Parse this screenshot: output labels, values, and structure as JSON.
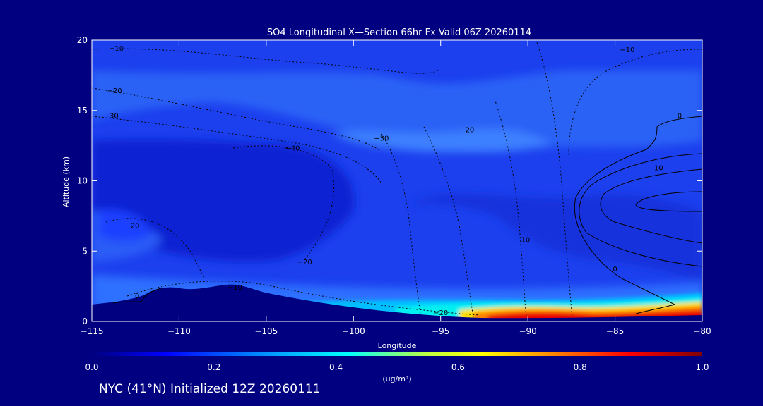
{
  "chart_data": {
    "type": "heatmap",
    "title": "SO4 Longitudinal X—Section 66hr  Fx Valid 06Z 20260114",
    "xlabel": "Longitude",
    "ylabel": "Altitude (km)",
    "xlim": [
      -115,
      -80
    ],
    "ylim": [
      0,
      20
    ],
    "x_ticks": [
      -115,
      -110,
      -105,
      -100,
      -95,
      -90,
      -85,
      -80
    ],
    "x_tick_labels": [
      "−115",
      "−110",
      "−105",
      "−100",
      "−95",
      "−90",
      "−85",
      "−80"
    ],
    "y_ticks": [
      0,
      5,
      10,
      15,
      20
    ],
    "y_tick_labels": [
      "0",
      "5",
      "10",
      "15",
      "20"
    ],
    "colorbar": {
      "label": "(ug/m³)",
      "range": [
        0.0,
        1.0
      ],
      "ticks": [
        0.0,
        0.2,
        0.4,
        0.6,
        0.8,
        1.0
      ],
      "tick_labels": [
        "0.0",
        "0.2",
        "0.4",
        "0.6",
        "0.8",
        "1.0"
      ],
      "colormap": [
        "#000080",
        "#0000ff",
        "#00a0ff",
        "#00ffff",
        "#c0ff40",
        "#ffff00",
        "#ff8000",
        "#ff0000",
        "#800000"
      ]
    },
    "field_summary": {
      "background_value": 0.1,
      "high_values_near_surface": [
        {
          "lon_range": [
            -92,
            -87
          ],
          "alt_km": 0.5,
          "value": 0.85
        },
        {
          "lon_range": [
            -83,
            -80
          ],
          "alt_km": 0.8,
          "value": 0.8
        },
        {
          "lon_range": [
            -96,
            -93
          ],
          "alt_km": 0.8,
          "value": 0.45
        }
      ]
    },
    "contour_labels": [
      {
        "text": "−10",
        "lon": -113.6,
        "alt": 19.4
      },
      {
        "text": "−20",
        "lon": -113.7,
        "alt": 16.4
      },
      {
        "text": "−30",
        "lon": -113.9,
        "alt": 14.6
      },
      {
        "text": "−40",
        "lon": -103.5,
        "alt": 12.3
      },
      {
        "text": "−30",
        "lon": -98.4,
        "alt": 13.0
      },
      {
        "text": "−20",
        "lon": -93.5,
        "alt": 13.6
      },
      {
        "text": "−10",
        "lon": -84.3,
        "alt": 19.3
      },
      {
        "text": "0",
        "lon": -81.3,
        "alt": 14.6
      },
      {
        "text": "10",
        "lon": -82.5,
        "alt": 10.9
      },
      {
        "text": "−20",
        "lon": -112.7,
        "alt": 6.8
      },
      {
        "text": "−20",
        "lon": -102.8,
        "alt": 4.2
      },
      {
        "text": "−10",
        "lon": -90.3,
        "alt": 5.8
      },
      {
        "text": "0",
        "lon": -85.0,
        "alt": 3.7
      },
      {
        "text": "−10",
        "lon": -106.8,
        "alt": 2.4
      },
      {
        "text": "0",
        "lon": -112.4,
        "alt": 1.8
      },
      {
        "text": "−20",
        "lon": -95.0,
        "alt": 0.6
      }
    ]
  },
  "footer": {
    "text": "NYC (41°N) Initialized 12Z 20260111"
  }
}
